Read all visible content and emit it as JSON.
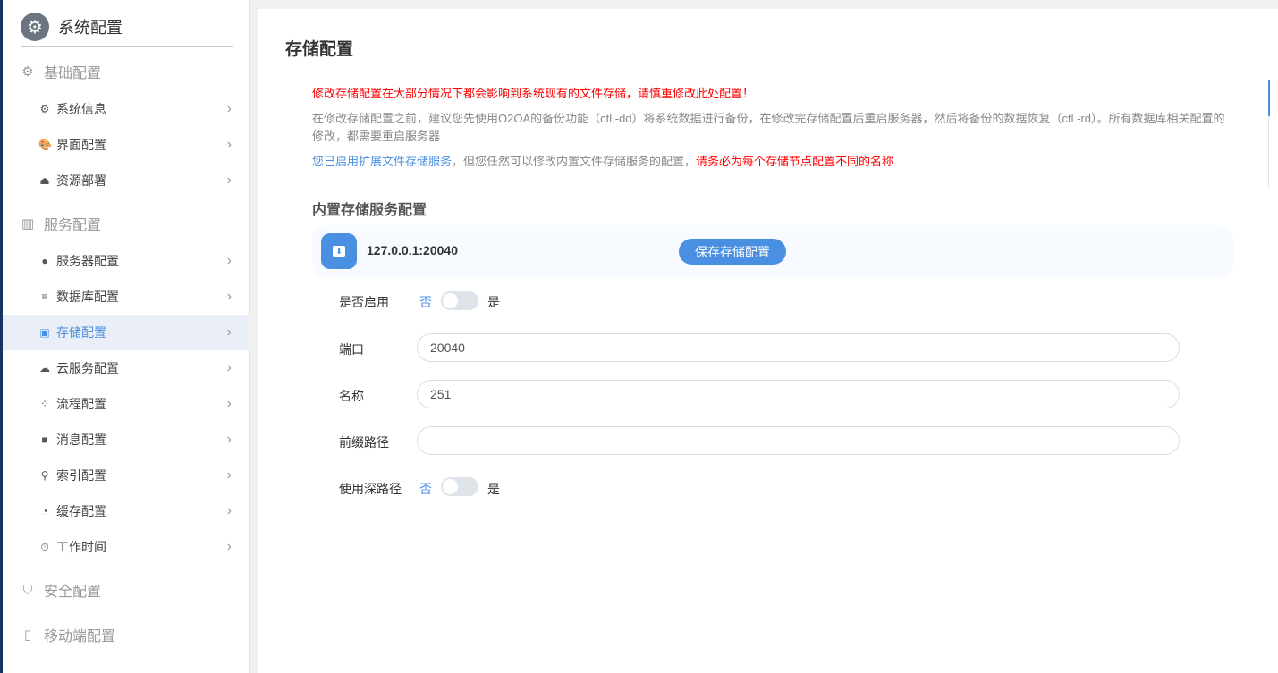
{
  "sidebar": {
    "title": "系统配置",
    "groups": [
      {
        "label": "基础配置",
        "items": [
          {
            "label": "系统信息"
          },
          {
            "label": "界面配置"
          },
          {
            "label": "资源部署"
          }
        ]
      },
      {
        "label": "服务配置",
        "items": [
          {
            "label": "服务器配置"
          },
          {
            "label": "数据库配置"
          },
          {
            "label": "存储配置",
            "active": true
          },
          {
            "label": "云服务配置"
          },
          {
            "label": "流程配置"
          },
          {
            "label": "消息配置"
          },
          {
            "label": "索引配置"
          },
          {
            "label": "缓存配置"
          },
          {
            "label": "工作时间"
          }
        ]
      },
      {
        "label": "安全配置"
      },
      {
        "label": "移动端配置"
      }
    ]
  },
  "main": {
    "title": "存储配置",
    "warning": "修改存储配置在大部分情况下都会影响到系统现有的文件存储，请慎重修改此处配置！",
    "advice": "在修改存储配置之前，建议您先使用O2OA的备份功能（ctl -dd）将系统数据进行备份，在修改完存储配置后重启服务器，然后将备份的数据恢复（ctl -rd）。所有数据库相关配置的修改，都需要重启服务器",
    "notice_blue": "您已启用扩展文件存储服务",
    "notice_gray": "，但您任然可以修改内置文件存储服务的配置，",
    "notice_red": "请务必为每个存储节点配置不同的名称",
    "section": "内置存储服务配置",
    "node": {
      "host": "127.0.0.1:20040",
      "save_label": "保存存储配置"
    },
    "form": {
      "enable_label": "是否启用",
      "enable_no": "否",
      "enable_yes": "是",
      "enabled": false,
      "port_label": "端口",
      "port": "20040",
      "name_label": "名称",
      "name": "251",
      "prefix_label": "前缀路径",
      "prefix": "",
      "deep_label": "使用深路径",
      "deep_no": "否",
      "deep_yes": "是",
      "deep": false
    }
  }
}
